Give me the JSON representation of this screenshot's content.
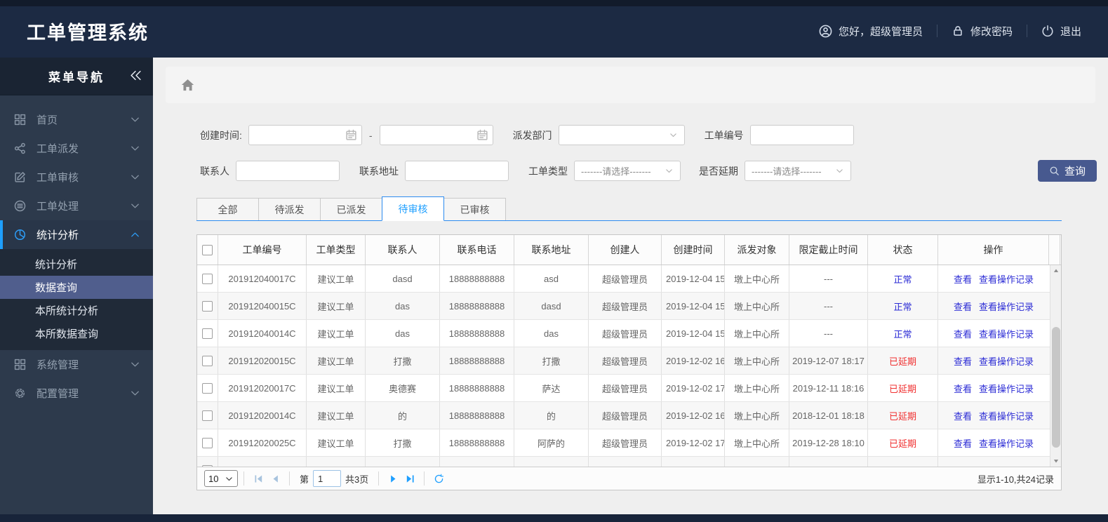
{
  "app": {
    "title": "工单管理系统"
  },
  "header": {
    "greeting": "您好，超级管理员",
    "greeting_icon": "user-icon",
    "change_password": "修改密码",
    "change_password_icon": "lock-icon",
    "logout": "退出",
    "logout_icon": "power-icon"
  },
  "sidebar": {
    "nav_title": "菜单导航",
    "collapse_icon": "double-chevron-left-icon",
    "items": [
      {
        "label": "首页",
        "icon": "dashboard-icon",
        "chevron": "down",
        "active": false
      },
      {
        "label": "工单派发",
        "icon": "share-icon",
        "chevron": "down",
        "active": false
      },
      {
        "label": "工单审核",
        "icon": "edit-icon",
        "chevron": "down",
        "active": false
      },
      {
        "label": "工单处理",
        "icon": "process-icon",
        "chevron": "down",
        "active": false
      },
      {
        "label": "统计分析",
        "icon": "pie-chart-icon",
        "chevron": "up",
        "active": true,
        "children": [
          {
            "label": "统计分析",
            "active": false
          },
          {
            "label": "数据查询",
            "active": true
          },
          {
            "label": "本所统计分析",
            "active": false
          },
          {
            "label": "本所数据查询",
            "active": false
          }
        ]
      },
      {
        "label": "系统管理",
        "icon": "grid-icon",
        "chevron": "down",
        "active": false
      },
      {
        "label": "配置管理",
        "icon": "gear-icon",
        "chevron": "down",
        "active": false
      }
    ]
  },
  "breadcrumb": {
    "home_icon": "home-icon"
  },
  "filters": {
    "create_time_label": "创建时间:",
    "create_time_start": "",
    "create_time_end": "",
    "range_separator": "-",
    "dispatch_dept_label": "派发部门",
    "dispatch_dept_value": "",
    "order_no_label": "工单编号",
    "order_no_value": "",
    "contact_label": "联系人",
    "contact_value": "",
    "address_label": "联系地址",
    "address_value": "",
    "order_type_label": "工单类型",
    "order_type_value": "-------请选择-------",
    "delay_label": "是否延期",
    "delay_value": "-------请选择-------",
    "search_button": "查询",
    "search_icon": "search-icon",
    "calendar_icon": "calendar-icon"
  },
  "tabs": [
    {
      "label": "全部",
      "active": false
    },
    {
      "label": "待派发",
      "active": false
    },
    {
      "label": "已派发",
      "active": false
    },
    {
      "label": "待审核",
      "active": true
    },
    {
      "label": "已审核",
      "active": false
    }
  ],
  "table": {
    "columns": [
      "工单编号",
      "工单类型",
      "联系人",
      "联系电话",
      "联系地址",
      "创建人",
      "创建时间",
      "派发对象",
      "限定截止时间",
      "状态",
      "操作"
    ],
    "rows": [
      {
        "order_no": "201912040017C",
        "order_type": "建议工单",
        "contact": "dasd",
        "phone": "18888888888",
        "address": "asd",
        "creator": "超级管理员",
        "create_time": "2019-12-04 15",
        "dispatch_target": "墩上中心所",
        "deadline": "---",
        "status": "正常",
        "status_type": "normal"
      },
      {
        "order_no": "201912040015C",
        "order_type": "建议工单",
        "contact": "das",
        "phone": "18888888888",
        "address": "dasd",
        "creator": "超级管理员",
        "create_time": "2019-12-04 15",
        "dispatch_target": "墩上中心所",
        "deadline": "---",
        "status": "正常",
        "status_type": "normal"
      },
      {
        "order_no": "201912040014C",
        "order_type": "建议工单",
        "contact": "das",
        "phone": "18888888888",
        "address": "das",
        "creator": "超级管理员",
        "create_time": "2019-12-04 15",
        "dispatch_target": "墩上中心所",
        "deadline": "---",
        "status": "正常",
        "status_type": "normal"
      },
      {
        "order_no": "201912020015C",
        "order_type": "建议工单",
        "contact": "打撒",
        "phone": "18888888888",
        "address": "打撒",
        "creator": "超级管理员",
        "create_time": "2019-12-02 16",
        "dispatch_target": "墩上中心所",
        "deadline": "2019-12-07 18:17",
        "status": "已延期",
        "status_type": "delayed"
      },
      {
        "order_no": "201912020017C",
        "order_type": "建议工单",
        "contact": "奥德赛",
        "phone": "18888888888",
        "address": "萨达",
        "creator": "超级管理员",
        "create_time": "2019-12-02 17",
        "dispatch_target": "墩上中心所",
        "deadline": "2019-12-11 18:16",
        "status": "已延期",
        "status_type": "delayed"
      },
      {
        "order_no": "201912020014C",
        "order_type": "建议工单",
        "contact": "的",
        "phone": "18888888888",
        "address": "的",
        "creator": "超级管理员",
        "create_time": "2019-12-02 16",
        "dispatch_target": "墩上中心所",
        "deadline": "2018-12-01 18:18",
        "status": "已延期",
        "status_type": "delayed"
      },
      {
        "order_no": "201912020025C",
        "order_type": "建议工单",
        "contact": "打撒",
        "phone": "18888888888",
        "address": "阿萨的",
        "creator": "超级管理员",
        "create_time": "2019-12-02 17",
        "dispatch_target": "墩上中心所",
        "deadline": "2019-12-28 18:10",
        "status": "已延期",
        "status_type": "delayed"
      }
    ],
    "actions": [
      "查看",
      "查看操作记录"
    ],
    "has_partial_row": true
  },
  "pagination": {
    "page_size": "10",
    "first_icon": "first-page-icon",
    "prev_icon": "prev-page-icon",
    "page_prefix": "第",
    "current_page": "1",
    "total_pages": "共3页",
    "next_icon": "next-page-icon",
    "last_icon": "last-page-icon",
    "refresh_icon": "refresh-icon",
    "summary": "显示1-10,共24记录"
  },
  "colors": {
    "header_bg": "#1c2a43",
    "sidebar_bg": "#2d3a4c",
    "accent_blue": "#2d8cf0",
    "link_blue": "#2b2bd5",
    "danger_red": "#f03030",
    "button_blue": "#47598f",
    "active_submenu_bg": "#505e8d"
  }
}
